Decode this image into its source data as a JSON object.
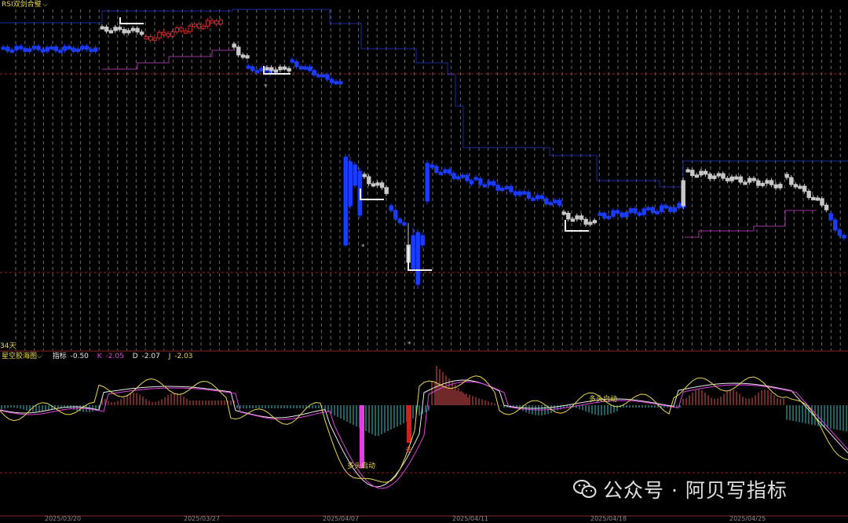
{
  "panel_top": {
    "title": "RSI双剑合璧",
    "days_label": "34天"
  },
  "panel_bottom": {
    "name": "星空胶海图",
    "label_indicator": "指标",
    "value_indicator": "-0.50",
    "label_k": "K",
    "value_k": "-2.05",
    "label_d": "D",
    "value_d": "-2.07",
    "label_j": "J",
    "value_j": "-2.03",
    "annotations": [
      "多头启动",
      "多头启动"
    ],
    "red_marker": "多"
  },
  "x_axis": {
    "dates": [
      "2025/03/20",
      "2025/03/27",
      "2025/04/07",
      "2025/04/11",
      "2025/04/18",
      "2025/04/25"
    ]
  },
  "watermark": {
    "text": "公众号 · 阿贝写指标",
    "icon": "wechat-icon"
  },
  "chart_data": [
    {
      "type": "candlestick",
      "series_colors": {
        "down": "#1a3cff",
        "flat": "#c8c8c8",
        "up": "#d22a2a"
      },
      "star_markers": [
        "*",
        "*",
        "*"
      ]
    },
    {
      "type": "bar",
      "note": "oscillator histogram with K/D/J lines",
      "colors": {
        "pos": "#e05050",
        "neg": "#30c8c8",
        "k": "#e040e0",
        "d": "#e8e8e8",
        "j": "#e8d84a"
      }
    }
  ]
}
